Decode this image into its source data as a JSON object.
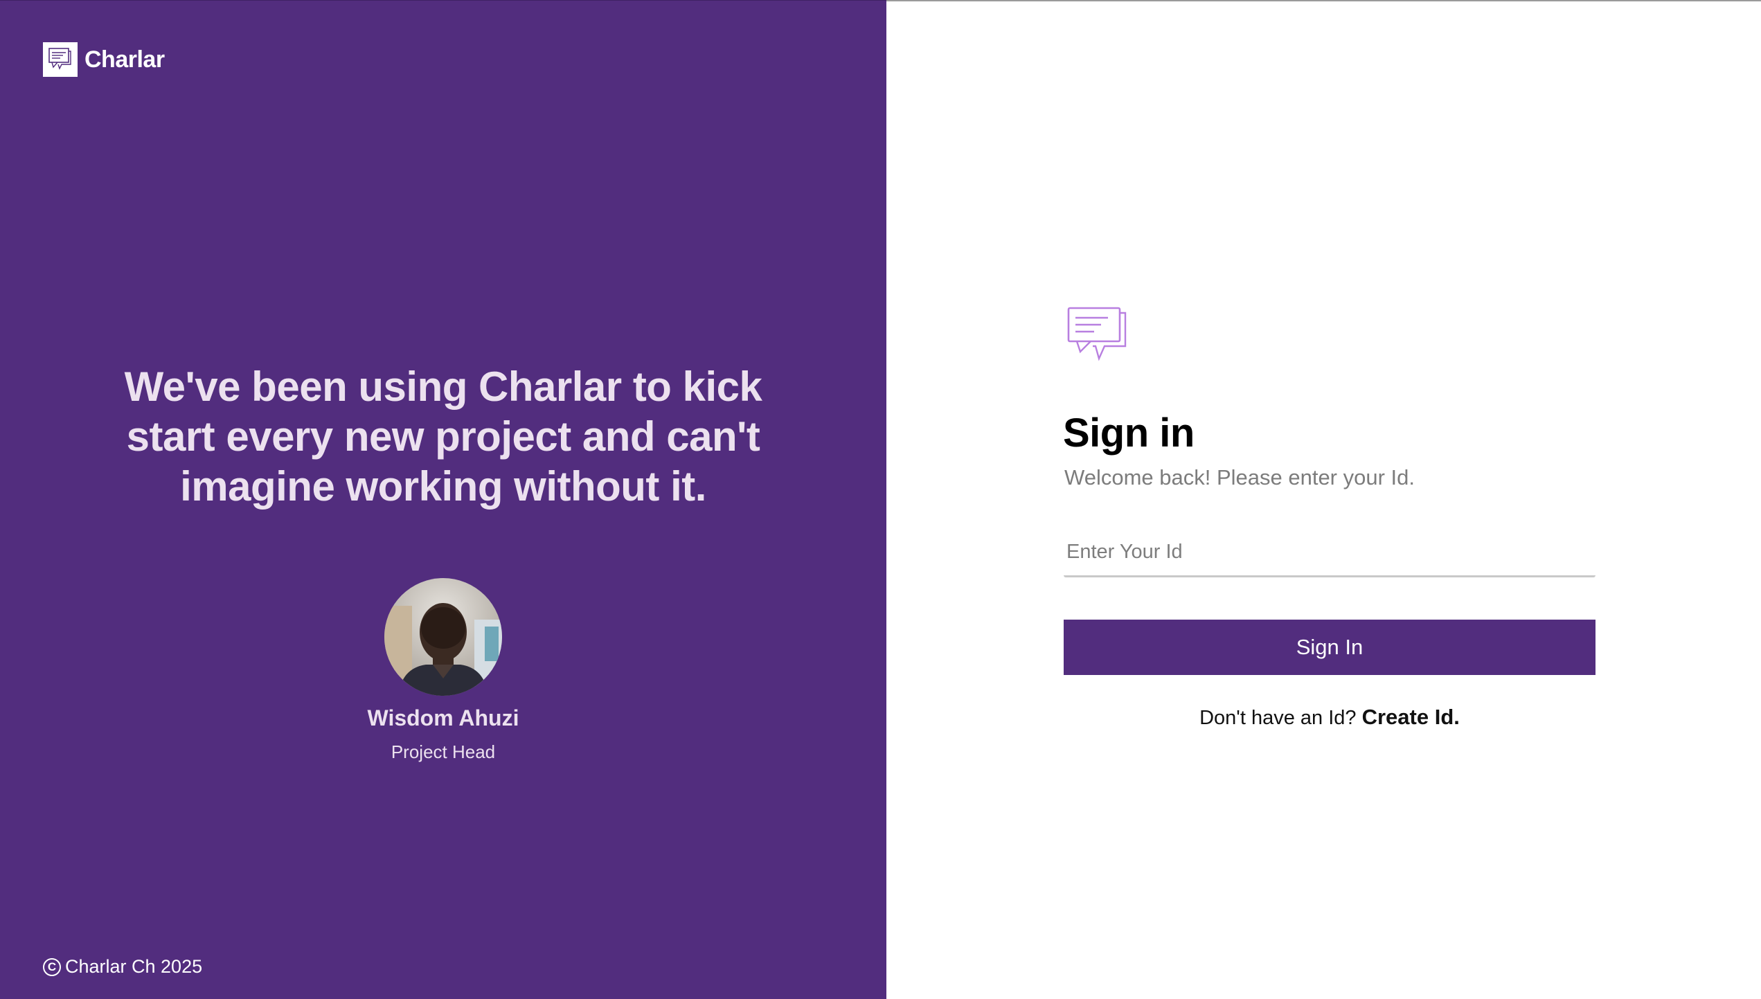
{
  "brand": {
    "name": "Charlar",
    "icon": "chat-bubbles-icon"
  },
  "testimonial": {
    "quote": "We've been using Charlar to kick start every new project and can't imagine working without it.",
    "person_name": "Wisdom Ahuzi",
    "person_role": "Project Head"
  },
  "footer": {
    "copyright_icon": "copyright-icon",
    "text": "Charlar Ch 2025"
  },
  "signin": {
    "logo_icon": "chat-bubbles-icon",
    "title": "Sign in",
    "subtitle": "Welcome back! Please enter your Id.",
    "id_placeholder": "Enter Your Id",
    "id_value": "",
    "button_label": "Sign In",
    "no_account_text": "Don't have an Id?",
    "create_link_label": "Create Id."
  },
  "colors": {
    "brand_purple": "#522d7e",
    "quote_text": "#ece1ef",
    "logo_stroke": "#b87fe0"
  }
}
